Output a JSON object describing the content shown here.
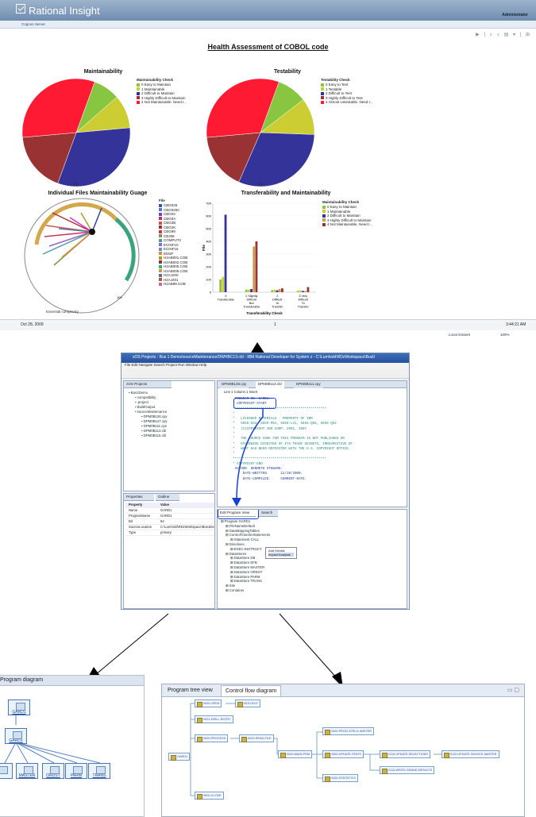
{
  "app": {
    "title": "Rational Insight",
    "user": "Administrator",
    "server": "Cognos Server",
    "toolbar_icons": "▶ | ⌕ ⌕ ▤ ▾ | ⊞"
  },
  "report": {
    "title": "Health Assessment of COBOL code",
    "date": "Oct 28, 2009",
    "page": "1",
    "time": "3:44:21 AM",
    "zone": "Local intranet",
    "zoom": "100%"
  },
  "charts": {
    "maintainability": {
      "title": "Maintainability",
      "legend_title": "Maintainability Check",
      "legend": [
        "0 Easy to Maintain",
        "1 Maintainable",
        "2 Difficult to Maintain",
        "3 Highly Difficult to Maintain",
        "4 Not Maintainable. Need I..."
      ],
      "caption": "File"
    },
    "testability": {
      "title": "Testability",
      "legend_title": "Testability Check",
      "legend": [
        "0 Easy to Test",
        "1 Testable",
        "2 Difficult to Test",
        "3 Highly Difficult to Test",
        "4 Almost Untestable. Need I..."
      ],
      "caption": "File"
    },
    "gauge": {
      "title": "Individual Files Maintainability Guage",
      "legend_title": "File",
      "files": [
        "CBG026",
        "CBG026C",
        "CBG03",
        "CBG0A",
        "CBG2B",
        "CBG2K",
        "CBG99",
        "CBJ99",
        "COMPUT2",
        "ECINF10",
        "ECINF16",
        "EM1P",
        "H2AB001.COB",
        "H2AB002.COB",
        "H2AB005.COB",
        "H2AB006.COB",
        "H2AJ200",
        "H2AJ201",
        "H2AB99.COB"
      ],
      "caption": "Essential complexity",
      "value_label": "100"
    },
    "transfer": {
      "title": "Transferability and Maintainability",
      "legend_title": "Maintainability Check",
      "legend": [
        "0 Easy to Maintain",
        "1 Maintainable",
        "2 Difficult to Maintain",
        "3 Highly Difficult to Maintain",
        "4 Not Maintainable. Need I..."
      ],
      "ylabel": "File",
      "xlabel": "Transferability Check",
      "yticks": [
        "0",
        "100",
        "200",
        "300",
        "400",
        "500",
        "600",
        "700"
      ],
      "categories": [
        "0 Transferable",
        "1 Slightly Difficult But Transferable",
        "2 Difficult to Transfer",
        "3 Very Difficult To Transfer"
      ]
    }
  },
  "chart_data": [
    {
      "type": "pie",
      "title": "Maintainability",
      "labels": [
        "0 Easy to Maintain",
        "1 Maintainable",
        "2 Difficult to Maintain",
        "3 Highly Difficult to Maintain",
        "4 Not Maintainable. Need I..."
      ],
      "values": [
        8,
        10,
        32,
        18,
        32
      ],
      "colors": [
        "#88c540",
        "#cccc33",
        "#333399",
        "#993333",
        "#ff1a33"
      ]
    },
    {
      "type": "pie",
      "title": "Testability",
      "labels": [
        "0 Easy to Test",
        "1 Testable",
        "2 Difficult to Test",
        "3 Highly Difficult to Test",
        "4 Almost Untestable. Need I..."
      ],
      "values": [
        9,
        11,
        31,
        17,
        32
      ],
      "colors": [
        "#88c540",
        "#cccc33",
        "#333399",
        "#993333",
        "#ff1a33"
      ]
    },
    {
      "type": "bar",
      "title": "Transferability and Maintainability",
      "xlabel": "Transferability Check",
      "ylabel": "File",
      "ylim": [
        0,
        700
      ],
      "categories": [
        "0 Transferable",
        "1 Slightly Difficult But Transferable",
        "2 Difficult to Transfer",
        "3 Very Difficult To Transfer"
      ],
      "series": [
        {
          "name": "0 Easy to Maintain",
          "values": [
            100,
            20,
            15,
            10
          ]
        },
        {
          "name": "1 Maintainable",
          "values": [
            120,
            20,
            20,
            15
          ]
        },
        {
          "name": "2 Difficult to Maintain",
          "values": [
            610,
            25,
            15,
            10
          ]
        },
        {
          "name": "3 Highly Difficult to Maintain",
          "values": [
            0,
            360,
            25,
            10
          ]
        },
        {
          "name": "4 Not Maintainable. Need I...",
          "values": [
            0,
            400,
            30,
            40
          ]
        }
      ],
      "colors": [
        "#88c540",
        "#cccc33",
        "#333399",
        "#cc9955",
        "#993333"
      ]
    }
  ],
  "ide": {
    "title": "zOS Projects - Bus 1 Demo/sourceMaintenance/DWHBC13.cbl - IBM Rational Developer for System z - C:\\Lumhold\\RDzWorkspace\\Bus0",
    "menu": "File  Edit  Navigate  Search  Project  Run  Window  Help",
    "projects_tab": "zOS Projects",
    "tree": [
      "Bus1Demo",
      "compatibility",
      ".project",
      "BuildOutput",
      "sourceMaintenance",
      "DPM0B126.cpy",
      "DPM0B127.cpy",
      "DPM0B111.cps",
      "DPM0B113.cbl",
      "DPM0B116.cbl"
    ],
    "editor_tabs": [
      "DPM0B126.cpy",
      "DPM0B113.cbl",
      "DPM0B111.cpy"
    ],
    "ruler": "Line 1       Column 1       Insert",
    "code": [
      "       PROGRAM-ID. GARD1.",
      "      * COPYRIGHT-START",
      "      ***********************************************",
      "      *",
      "      *   LICENSED MATERIALS - PROPERTY OF IBM",
      "      *   5655-G53, 5655-M61, 5655-L21, 5655-Q66, 5655-Q92",
      "      *   (C)COPYRIGHT IBM CORP. 2001, 2007",
      "      *",
      "      *   THE SOURCE CODE FOR THIS PROGRAM IS NOT PUBLISHED OR",
      "      *   OTHERWISE DIVESTED OF ITS TRADE SECRETS, IRRESPECTIVE OF",
      "      *   WHAT HAS BEEN DEPOSITED WITH THE U.S. COPYRIGHT OFFICE.",
      "      *",
      "      ***********************************************",
      "      * COPYRIGHT-END",
      "",
      "       AUTHOR. KENNETH STEWARD.",
      "           DATE-WRITTEN.      12/10/2000.",
      "           DATE-COMPILED.     CURRENT-DATE."
    ],
    "props_tabs": [
      "Properties",
      "Outline"
    ],
    "props_header": [
      "Property",
      "Value"
    ],
    "props": [
      [
        "Name",
        "GARD1"
      ],
      [
        "ProgramName",
        "GARD1"
      ],
      [
        "Bit",
        "64"
      ],
      [
        "SourceLocation",
        "C:\\Lumhold\\RDzWorkspace\\Bus1Demo"
      ],
      [
        "Type",
        "primary"
      ]
    ],
    "tree_view_tab": "Edit Program View",
    "search_tab": "Search",
    "program_tree": [
      "Program GARD1",
      "FileNameDefault",
      "DataMappingTables",
      "ControlTransferStatements",
      "Statement CALL",
      "Directives",
      "EXEC-INSTRUCT",
      "DataStores",
      "DataStore DB",
      "DataStore EFB",
      "DataStore MASTER",
      "DataStore ORDST",
      "DataStore PARM",
      "DataStore TRANS",
      "Site",
      "Container"
    ],
    "context_menu": [
      "Add Details",
      "Impact Analysis"
    ]
  },
  "program_diagram": {
    "tab": "Program diagram",
    "nodes": [
      "GARD1",
      "GARD1",
      "MASTER",
      "ORDST",
      "PARM",
      "TRANS"
    ]
  },
  "control_flow": {
    "tabs": [
      "Program tree view",
      "Control flow diagram"
    ],
    "nodes": [
      "GARD1",
      "0000-OPEN",
      "0001-DRILL-ENTRY",
      "0000-PROCESS",
      "0200-READ-FILE",
      "0010-EXIT",
      "0300-PROD-STRLG-WRITER",
      "0000-MAIN-PGM",
      "0300-UPDATE-STATS",
      "0110-UPDATE-SELECTIONS",
      "0112-UPDATE-INVOICE-MASTER",
      "0113-WRITE-GRAND-RESULTS",
      "0400-STATISTICS",
      "0900-CLOSE"
    ]
  }
}
